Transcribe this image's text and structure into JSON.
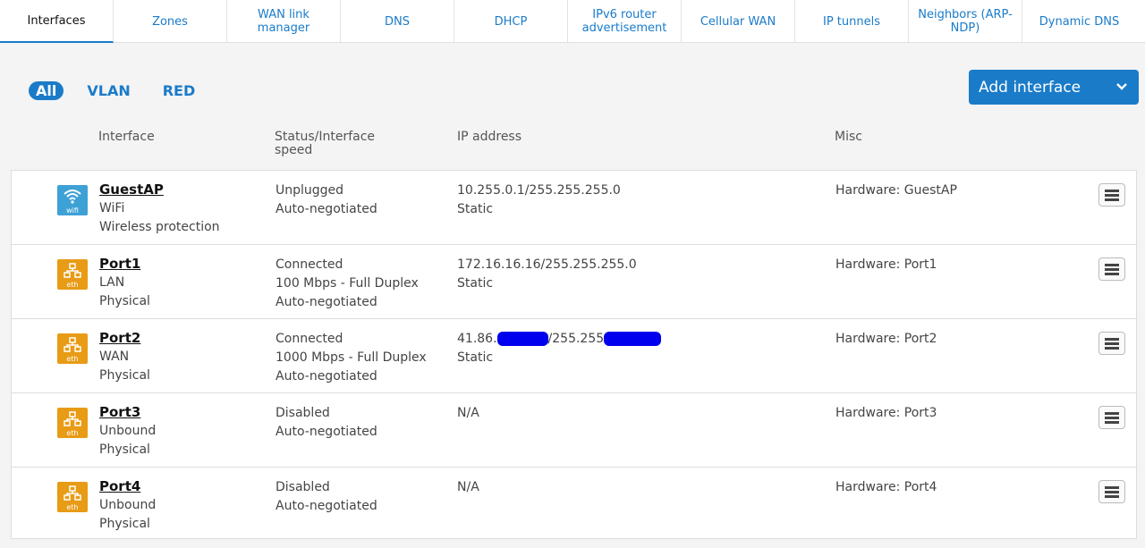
{
  "tabs": [
    "Interfaces",
    "Zones",
    "WAN link manager",
    "DNS",
    "DHCP",
    "IPv6 router advertisement",
    "Cellular WAN",
    "IP tunnels",
    "Neighbors (ARP-NDP)",
    "Dynamic DNS"
  ],
  "filters": [
    "All",
    "VLAN",
    "RED"
  ],
  "add_button": "Add interface",
  "columns": {
    "interface": "Interface",
    "status": "Status/Interface speed",
    "ip": "IP address",
    "misc": "Misc"
  },
  "rows": [
    {
      "name": "GuestAP",
      "icon": "wifi-icon",
      "icon_label": "wifi",
      "iface_lines": [
        "WiFi",
        "Wireless protection"
      ],
      "status_lines": [
        "Unplugged",
        "Auto-negotiated"
      ],
      "ip_lines": [
        "10.255.0.1/255.255.255.0",
        "Static"
      ],
      "misc": "Hardware:  GuestAP"
    },
    {
      "name": "Port1",
      "icon": "ethernet-icon",
      "icon_label": "eth",
      "iface_lines": [
        "LAN",
        "Physical"
      ],
      "status_lines": [
        "Connected",
        "100 Mbps - Full Duplex",
        "Auto-negotiated"
      ],
      "ip_lines": [
        "172.16.16.16/255.255.255.0",
        "Static"
      ],
      "misc": "Hardware:  Port1"
    },
    {
      "name": "Port2",
      "icon": "ethernet-icon",
      "icon_label": "eth",
      "iface_lines": [
        "WAN",
        "Physical"
      ],
      "status_lines": [
        "Connected",
        "1000 Mbps - Full Duplex",
        "Auto-negotiated"
      ],
      "ip_parts": [
        "41.86.",
        "/255.255"
      ],
      "ip_lines": [
        "Static"
      ],
      "misc": "Hardware:  Port2"
    },
    {
      "name": "Port3",
      "icon": "ethernet-icon",
      "icon_label": "eth",
      "iface_lines": [
        "Unbound",
        "Physical"
      ],
      "status_lines": [
        "Disabled",
        "Auto-negotiated"
      ],
      "ip_lines": [
        "N/A"
      ],
      "misc": "Hardware:  Port3"
    },
    {
      "name": "Port4",
      "icon": "ethernet-icon",
      "icon_label": "eth",
      "iface_lines": [
        "Unbound",
        "Physical"
      ],
      "status_lines": [
        "Disabled",
        "Auto-negotiated"
      ],
      "ip_lines": [
        "N/A"
      ],
      "misc": "Hardware:  Port4"
    }
  ],
  "colors": {
    "accent": "#1a7bc9",
    "wifi": "#3ea1d6",
    "eth": "#e89b15",
    "redaction": "#0000ee"
  }
}
